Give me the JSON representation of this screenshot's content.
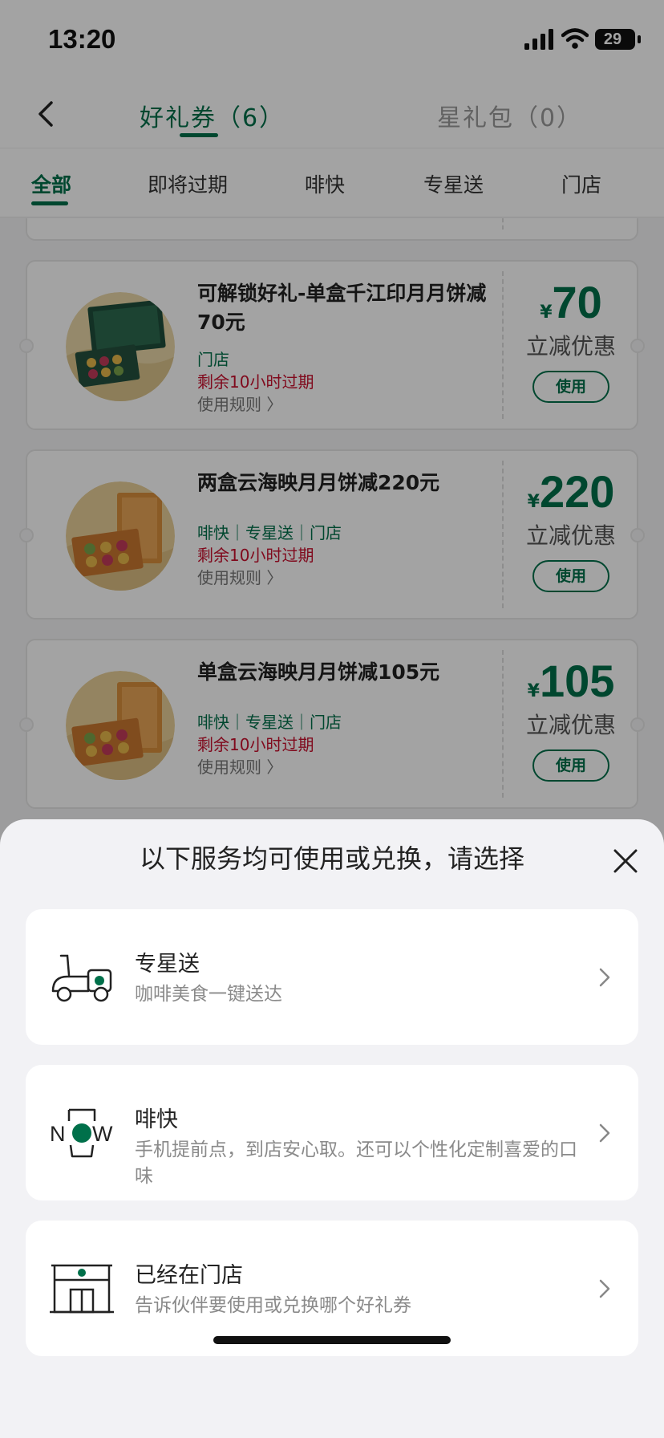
{
  "status_bar": {
    "time": "13:20",
    "battery": "29"
  },
  "nav": {
    "tab_coupons": "好礼券（6）",
    "tab_star_pack": "星礼包（0）"
  },
  "filters": [
    "全部",
    "即将过期",
    "啡快",
    "专星送",
    "门店"
  ],
  "coupons": [
    {
      "title": "可解锁好礼-单盒千江印月月饼减70元",
      "channels": "门店",
      "expiry": "剩余10小时过期",
      "rules": "使用规则 〉",
      "currency": "¥",
      "amount": "70",
      "discount_label": "立减优惠",
      "use_label": "使用"
    },
    {
      "title": "两盒云海映月月饼减220元",
      "channels": "啡快｜专星送｜门店",
      "expiry": "剩余10小时过期",
      "rules": "使用规则 〉",
      "currency": "¥",
      "amount": "220",
      "discount_label": "立减优惠",
      "use_label": "使用"
    },
    {
      "title": "单盒云海映月月饼减105元",
      "channels": "啡快｜专星送｜门店",
      "expiry": "剩余10小时过期",
      "rules": "使用规则 〉",
      "currency": "¥",
      "amount": "105",
      "discount_label": "立减优惠",
      "use_label": "使用"
    }
  ],
  "sheet": {
    "title": "以下服务均可使用或兑换，请选择",
    "options": [
      {
        "icon": "scooter-icon",
        "title": "专星送",
        "desc": "咖啡美食一键送达"
      },
      {
        "icon": "now-icon",
        "title": "啡快",
        "desc": "手机提前点，到店安心取。还可以个性化定制喜爱的口味"
      },
      {
        "icon": "store-icon",
        "title": "已经在门店",
        "desc": "告诉伙伴要使用或兑换哪个好礼券"
      }
    ]
  },
  "colors": {
    "brand_green": "#00704a",
    "expiry_red": "#c8102e"
  }
}
